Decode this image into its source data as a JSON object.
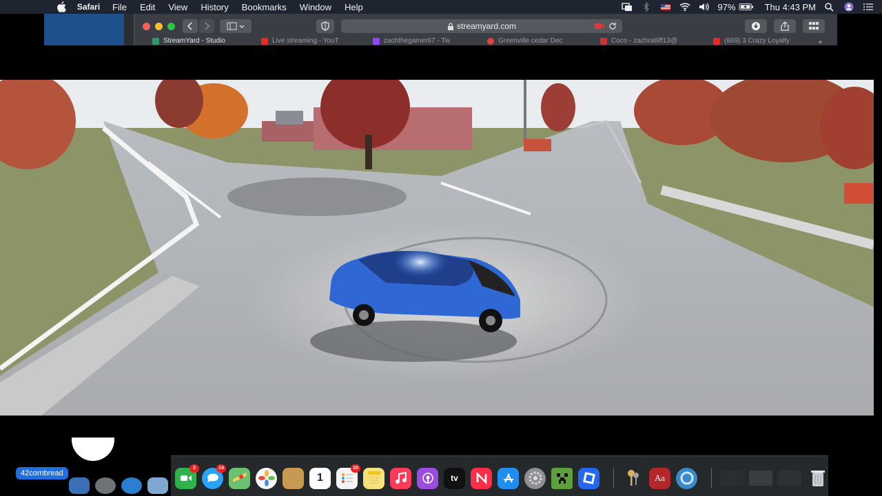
{
  "menubar": {
    "app_name": "Safari",
    "menus": [
      "File",
      "Edit",
      "View",
      "History",
      "Bookmarks",
      "Window",
      "Help"
    ],
    "battery": "97%",
    "clock": "Thu 4:43 PM"
  },
  "browser": {
    "url": "streamyard.com",
    "tabs": [
      {
        "label": "StreamYard - Studio",
        "color": "#2d9b6a"
      },
      {
        "label": "Live streaming - YouT",
        "color": "#e52d27"
      },
      {
        "label": "zachthegamer67 - Tw",
        "color": "#9146ff"
      },
      {
        "label": "Greenville cedar Dec",
        "color": "#d44"
      },
      {
        "label": "Coco - zachratliff13@",
        "color": "#c33"
      },
      {
        "label": "(869) 3 Crazy Loyalty",
        "color": "#e52d27"
      }
    ]
  },
  "video": {
    "scene": "game-driving-scene"
  },
  "user": {
    "name": "42cornbread"
  },
  "dock": {
    "apps": [
      {
        "name": "facetime",
        "color": "#2fb24c",
        "badge": "3"
      },
      {
        "name": "messages",
        "color": "#29a3f5",
        "badge": "14"
      },
      {
        "name": "maps",
        "color": "#6cc070",
        "badge": ""
      },
      {
        "name": "photos",
        "color": "#f7f7f7",
        "badge": ""
      },
      {
        "name": "notes-brown",
        "color": "#c79a54",
        "badge": ""
      },
      {
        "name": "calendar",
        "color": "#ffffff",
        "badge": "",
        "text": "1"
      },
      {
        "name": "reminders",
        "color": "#f4f4f4",
        "badge": "10"
      },
      {
        "name": "notes",
        "color": "#f7e27a",
        "badge": ""
      },
      {
        "name": "music",
        "color": "#fa3c5a",
        "badge": ""
      },
      {
        "name": "podcasts",
        "color": "#9b4de0",
        "badge": ""
      },
      {
        "name": "apple-tv",
        "color": "#111111",
        "badge": "",
        "text": "tv"
      },
      {
        "name": "news",
        "color": "#fa2e49",
        "badge": ""
      },
      {
        "name": "app-store",
        "color": "#1f8ef1",
        "badge": ""
      },
      {
        "name": "system-preferences",
        "color": "#8e8e93",
        "badge": ""
      },
      {
        "name": "minecraft",
        "color": "#5ea03b",
        "badge": ""
      },
      {
        "name": "roblox",
        "color": "#2468f2",
        "badge": ""
      }
    ],
    "right_apps": [
      {
        "name": "keychain",
        "color": "#d9b45a"
      },
      {
        "name": "dictionary",
        "color": "#b3262a",
        "text": "Aa"
      },
      {
        "name": "screen-recorder",
        "color": "#3a89c9"
      }
    ]
  }
}
